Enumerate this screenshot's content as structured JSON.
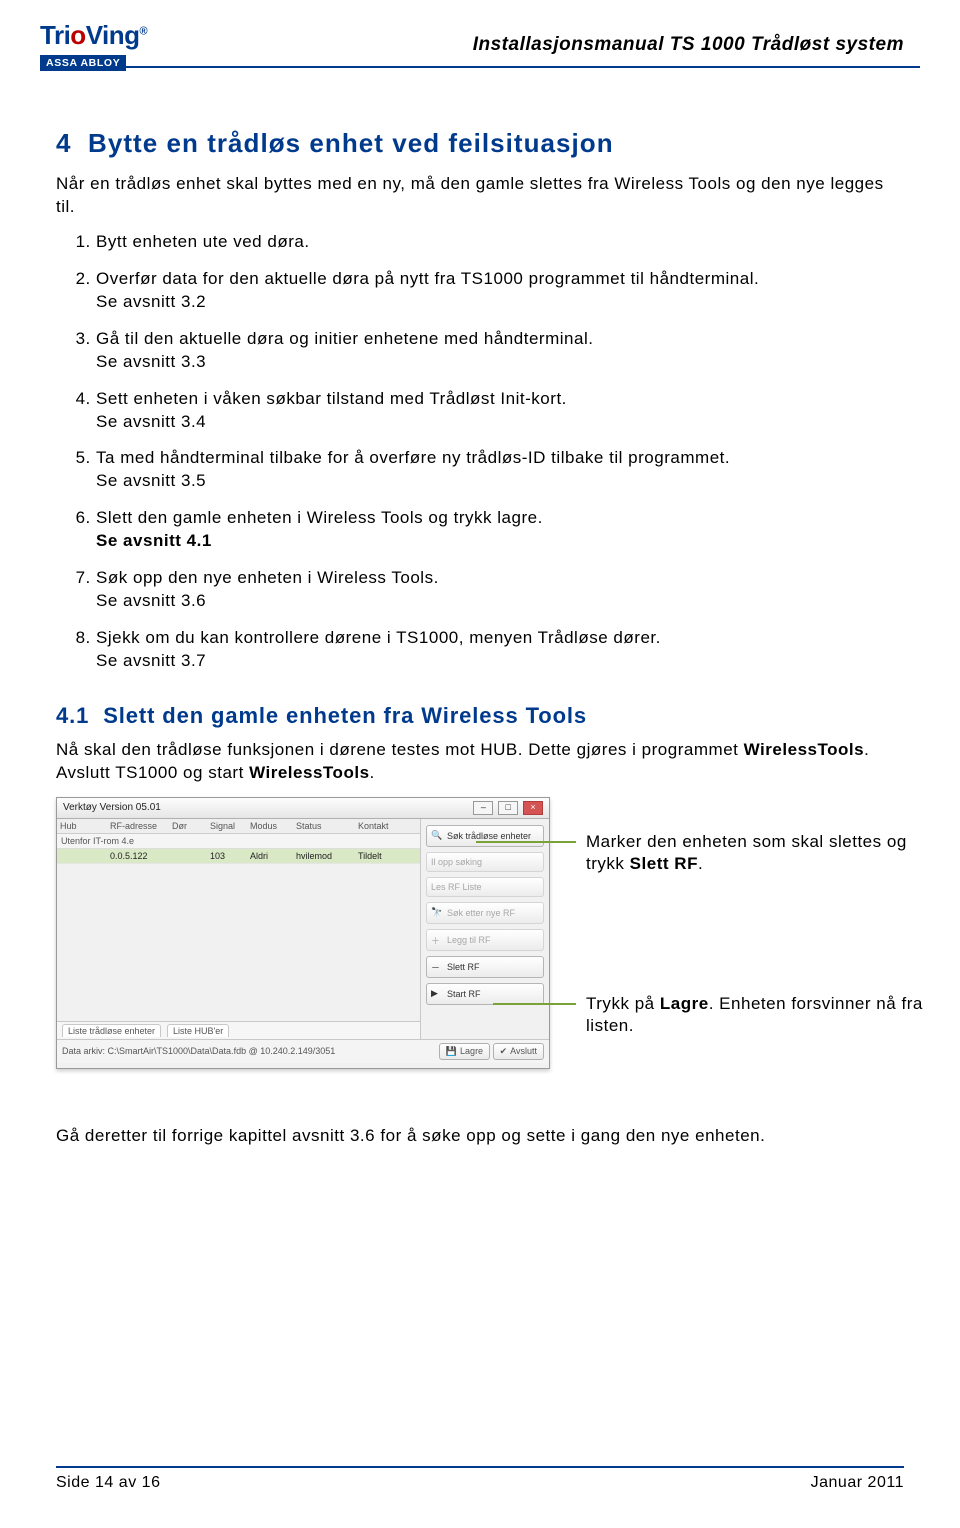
{
  "header": {
    "doc_title": "Installasjonsmanual TS 1000 Trådløst system",
    "logo_main": "TrioVing",
    "logo_sub": "ASSA ABLOY"
  },
  "section": {
    "num": "4",
    "title": "Bytte en trådløs enhet ved feilsituasjon",
    "intro": "Når en trådløs enhet skal byttes med en ny, må den gamle slettes fra Wireless Tools og den nye legges til."
  },
  "steps": [
    {
      "text": "Bytt enheten ute ved døra.",
      "ref": ""
    },
    {
      "text": "Overfør data for den aktuelle døra på nytt fra TS1000 programmet til håndterminal.",
      "ref": "Se avsnitt 3.2"
    },
    {
      "text": "Gå til den aktuelle døra og initier enhetene med håndterminal.",
      "ref": "Se avsnitt 3.3"
    },
    {
      "text": "Sett enheten i våken søkbar tilstand med Trådløst Init-kort.",
      "ref": "Se avsnitt 3.4"
    },
    {
      "text": "Ta med håndterminal tilbake for å overføre ny trådløs-ID tilbake til programmet.",
      "ref": "Se avsnitt 3.5"
    },
    {
      "text": "Slett den gamle enheten i Wireless Tools og trykk lagre.",
      "ref": "Se avsnitt 4.1",
      "ref_bold": true
    },
    {
      "text": "Søk opp den nye enheten i Wireless Tools.",
      "ref": "Se avsnitt 3.6"
    },
    {
      "text": "Sjekk om du kan kontrollere dørene i TS1000, menyen Trådløse dører.",
      "ref": "Se avsnitt 3.7"
    }
  ],
  "subsection": {
    "num": "4.1",
    "title": "Slett den gamle enheten fra Wireless Tools",
    "para_a": "Nå skal den trådløse funksjonen i dørene testes mot HUB.  Dette gjøres i programmet ",
    "para_b": "WirelessTools",
    "para_c": ". Avslutt TS1000 og start ",
    "para_d": "WirelessTools",
    "para_e": "."
  },
  "callouts": {
    "c1a": "Marker den enheten som skal slettes og trykk ",
    "c1b": "Slett RF",
    "c1c": ".",
    "c2a": "Trykk på ",
    "c2b": "Lagre",
    "c2c": ". Enheten forsvinner nå fra listen."
  },
  "window": {
    "title": "Verktøy Version 05.01",
    "caption": "Utenfor IT-rom 4.e",
    "headers": [
      "Hub",
      "RF-adresse",
      "Dør",
      "Signal",
      "Modus",
      "Status",
      "Kontakt"
    ],
    "row": [
      "",
      "0.0.5.122",
      "",
      "103",
      "Aldri",
      "hvilemod",
      "Tildelt"
    ],
    "btns": {
      "sok_enh": "Søk trådløse enheter",
      "il": "Il opp søking",
      "les": "Les RF Liste",
      "sok_nye": "Søk etter nye RF",
      "legg": "Legg til RF",
      "slett": "Slett RF",
      "start": "Start RF"
    },
    "tabs": {
      "a": "Liste trådløse enheter",
      "b": "Liste HUB'er"
    },
    "status_path": "Data arkiv:  C:\\SmartAir\\TS1000\\Data\\Data.fdb @ 10.240.2.149/3051",
    "lagre": "Lagre",
    "avslutt": "Avslutt"
  },
  "closing": "Gå deretter til forrige kapittel avsnitt 3.6 for å søke opp og sette i gang den nye enheten.",
  "footer": {
    "page": "Side 14 av 16",
    "date": "Januar 2011"
  }
}
